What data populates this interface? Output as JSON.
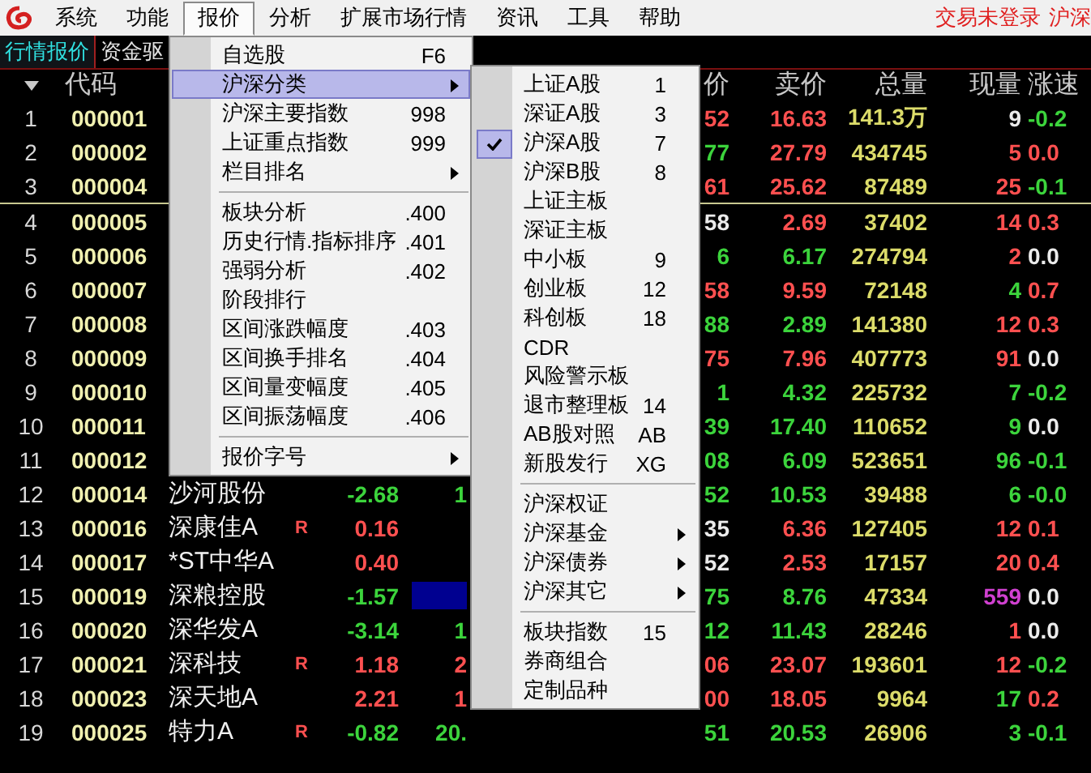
{
  "menubar": {
    "items": [
      {
        "label": "系统",
        "selected": false
      },
      {
        "label": "功能",
        "selected": false
      },
      {
        "label": "报价",
        "selected": true
      },
      {
        "label": "分析",
        "selected": false
      },
      {
        "label": "扩展市场行情",
        "selected": false
      },
      {
        "label": "资讯",
        "selected": false
      },
      {
        "label": "工具",
        "selected": false
      },
      {
        "label": "帮助",
        "selected": false
      }
    ],
    "login_status": "交易未登录",
    "market": "沪深"
  },
  "tabs": [
    {
      "label": "行情报价",
      "selected": true
    },
    {
      "label": "资金驱",
      "selected": false
    }
  ],
  "table": {
    "header": {
      "code": "代码",
      "bid": "价",
      "ask": "卖价",
      "volume": "总量",
      "current": "现量",
      "speed": "涨速"
    },
    "rows": [
      {
        "no": "1",
        "code": "000001",
        "bid": {
          "text": "52",
          "color": "#ff5050"
        },
        "ask": {
          "text": "16.63",
          "color": "#ff5050"
        },
        "volume": "141.3万",
        "current": {
          "text": "9",
          "color": "#ebebeb"
        },
        "speed": {
          "text": "-0.2",
          "color": "#3cd43c"
        },
        "marked": false,
        "divider_below": false
      },
      {
        "no": "2",
        "code": "000002",
        "bid": {
          "text": "77",
          "color": "#3cd43c"
        },
        "ask": {
          "text": "27.79",
          "color": "#ff5050"
        },
        "volume": "434745",
        "current": {
          "text": "5",
          "color": "#ff5050"
        },
        "speed": {
          "text": "0.0",
          "color": "#ff5050"
        },
        "marked": false,
        "divider_below": false
      },
      {
        "no": "3",
        "code": "000004",
        "bid": {
          "text": "61",
          "color": "#ff5050"
        },
        "ask": {
          "text": "25.62",
          "color": "#ff5050"
        },
        "volume": "87489",
        "current": {
          "text": "25",
          "color": "#ff5050"
        },
        "speed": {
          "text": "-0.1",
          "color": "#3cd43c"
        },
        "marked": false,
        "divider_below": true
      },
      {
        "no": "4",
        "code": "000005",
        "bid": {
          "text": "58",
          "color": "#ebebeb"
        },
        "ask": {
          "text": "2.69",
          "color": "#ff5050"
        },
        "volume": "37402",
        "current": {
          "text": "14",
          "color": "#ff5050"
        },
        "speed": {
          "text": "0.3",
          "color": "#ff5050"
        },
        "marked": false,
        "divider_below": false
      },
      {
        "no": "5",
        "code": "000006",
        "bid": {
          "text": "6",
          "color": "#3cd43c"
        },
        "ask": {
          "text": "6.17",
          "color": "#3cd43c"
        },
        "volume": "274794",
        "current": {
          "text": "2",
          "color": "#ff5050"
        },
        "speed": {
          "text": "0.0",
          "color": "#ebebeb"
        },
        "marked": false,
        "divider_below": false
      },
      {
        "no": "6",
        "code": "000007",
        "bid": {
          "text": "58",
          "color": "#ff5050"
        },
        "ask": {
          "text": "9.59",
          "color": "#ff5050"
        },
        "volume": "72148",
        "current": {
          "text": "4",
          "color": "#3cd43c"
        },
        "speed": {
          "text": "0.7",
          "color": "#ff5050"
        },
        "marked": false,
        "divider_below": false
      },
      {
        "no": "7",
        "code": "000008",
        "bid": {
          "text": "88",
          "color": "#3cd43c"
        },
        "ask": {
          "text": "2.89",
          "color": "#3cd43c"
        },
        "volume": "141380",
        "current": {
          "text": "12",
          "color": "#ff5050"
        },
        "speed": {
          "text": "0.3",
          "color": "#ff5050"
        },
        "marked": false,
        "divider_below": false
      },
      {
        "no": "8",
        "code": "000009",
        "bid": {
          "text": "75",
          "color": "#ff5050"
        },
        "ask": {
          "text": "7.96",
          "color": "#ff5050"
        },
        "volume": "407773",
        "current": {
          "text": "91",
          "color": "#ff5050"
        },
        "speed": {
          "text": "0.0",
          "color": "#ebebeb"
        },
        "marked": false,
        "divider_below": false
      },
      {
        "no": "9",
        "code": "000010",
        "bid": {
          "text": "1",
          "color": "#3cd43c"
        },
        "ask": {
          "text": "4.32",
          "color": "#3cd43c"
        },
        "volume": "225732",
        "current": {
          "text": "7",
          "color": "#3cd43c"
        },
        "speed": {
          "text": "-0.2",
          "color": "#3cd43c"
        },
        "marked": false,
        "divider_below": false
      },
      {
        "no": "10",
        "code": "000011",
        "bid": {
          "text": "39",
          "color": "#3cd43c"
        },
        "ask": {
          "text": "17.40",
          "color": "#3cd43c"
        },
        "volume": "110652",
        "current": {
          "text": "9",
          "color": "#3cd43c"
        },
        "speed": {
          "text": "0.0",
          "color": "#ebebeb"
        },
        "marked": false,
        "divider_below": false
      },
      {
        "no": "11",
        "code": "000012",
        "bid": {
          "text": "08",
          "color": "#3cd43c"
        },
        "ask": {
          "text": "6.09",
          "color": "#3cd43c"
        },
        "volume": "523651",
        "current": {
          "text": "96",
          "color": "#3cd43c"
        },
        "speed": {
          "text": "-0.1",
          "color": "#3cd43c"
        },
        "marked": false,
        "divider_below": false
      },
      {
        "no": "12",
        "code": "000014",
        "name": "沙河股份",
        "change": {
          "text": "-2.68",
          "color": "#3cd43c"
        },
        "col_6": {
          "text": "1",
          "color": "#3cd43c"
        },
        "bid": {
          "text": "52",
          "color": "#3cd43c"
        },
        "ask": {
          "text": "10.53",
          "color": "#3cd43c"
        },
        "volume": "39488",
        "current": {
          "text": "6",
          "color": "#3cd43c"
        },
        "speed": {
          "text": "-0.0",
          "color": "#3cd43c"
        },
        "marked": false,
        "divider_below": false
      },
      {
        "no": "13",
        "code": "000016",
        "name": "深康佳A",
        "flag": "R",
        "change": {
          "text": "0.16",
          "color": "#ff5050"
        },
        "bid": {
          "text": "35",
          "color": "#ebebeb"
        },
        "ask": {
          "text": "6.36",
          "color": "#ff5050"
        },
        "volume": "127405",
        "current": {
          "text": "12",
          "color": "#ff5050"
        },
        "speed": {
          "text": "0.1",
          "color": "#ff5050"
        },
        "marked": false,
        "divider_below": false
      },
      {
        "no": "14",
        "code": "000017",
        "name": "*ST中华A",
        "change": {
          "text": "0.40",
          "color": "#ff5050"
        },
        "bid": {
          "text": "52",
          "color": "#ebebeb"
        },
        "ask": {
          "text": "2.53",
          "color": "#ff5050"
        },
        "volume": "17157",
        "current": {
          "text": "20",
          "color": "#ff5050"
        },
        "speed": {
          "text": "0.4",
          "color": "#ff5050"
        },
        "marked": false,
        "divider_below": false
      },
      {
        "no": "15",
        "code": "000019",
        "name": "深粮控股",
        "change": {
          "text": "-1.57",
          "color": "#3cd43c"
        },
        "bid": {
          "text": "75",
          "color": "#3cd43c"
        },
        "ask": {
          "text": "8.76",
          "color": "#3cd43c"
        },
        "volume": "47334",
        "current": {
          "text": "559",
          "color": "#d040d0"
        },
        "speed": {
          "text": "0.0",
          "color": "#ebebeb"
        },
        "marked": true,
        "divider_below": false
      },
      {
        "no": "16",
        "code": "000020",
        "name": "深华发A",
        "change": {
          "text": "-3.14",
          "color": "#3cd43c"
        },
        "col_6": {
          "text": "1",
          "color": "#3cd43c"
        },
        "bid": {
          "text": "12",
          "color": "#3cd43c"
        },
        "ask": {
          "text": "11.43",
          "color": "#3cd43c"
        },
        "volume": "28246",
        "current": {
          "text": "1",
          "color": "#ff5050"
        },
        "speed": {
          "text": "0.0",
          "color": "#ebebeb"
        },
        "marked": false,
        "divider_below": false
      },
      {
        "no": "17",
        "code": "000021",
        "name": "深科技",
        "flag": "R",
        "change": {
          "text": "1.18",
          "color": "#ff5050"
        },
        "col_6": {
          "text": "2",
          "color": "#ff5050"
        },
        "bid": {
          "text": "06",
          "color": "#ff5050"
        },
        "ask": {
          "text": "23.07",
          "color": "#ff5050"
        },
        "volume": "193601",
        "current": {
          "text": "12",
          "color": "#ff5050"
        },
        "speed": {
          "text": "-0.2",
          "color": "#3cd43c"
        },
        "marked": false,
        "divider_below": false
      },
      {
        "no": "18",
        "code": "000023",
        "name": "深天地A",
        "change": {
          "text": "2.21",
          "color": "#ff5050"
        },
        "col_6": {
          "text": "1",
          "color": "#ff5050"
        },
        "bid": {
          "text": "00",
          "color": "#ff5050"
        },
        "ask": {
          "text": "18.05",
          "color": "#ff5050"
        },
        "volume": "9964",
        "current": {
          "text": "17",
          "color": "#3cd43c"
        },
        "speed": {
          "text": "0.2",
          "color": "#ff5050"
        },
        "marked": false,
        "divider_below": false
      },
      {
        "no": "19",
        "code": "000025",
        "name": "特力A",
        "flag": "R",
        "change": {
          "text": "-0.82",
          "color": "#3cd43c"
        },
        "col_6": {
          "text": "20.",
          "color": "#3cd43c"
        },
        "bid": {
          "text": "51",
          "color": "#3cd43c"
        },
        "ask": {
          "text": "20.53",
          "color": "#3cd43c"
        },
        "volume": "26906",
        "current": {
          "text": "3",
          "color": "#3cd43c"
        },
        "speed": {
          "text": "-0.1",
          "color": "#3cd43c"
        },
        "marked": false,
        "divider_below": false
      }
    ]
  },
  "quote_menu": [
    {
      "label": "自选股",
      "shortcut": "F6",
      "kind": "item",
      "selected": false
    },
    {
      "label": "沪深分类",
      "kind": "submenu",
      "selected": true
    },
    {
      "label": "沪深主要指数",
      "shortcut": "998",
      "kind": "item",
      "selected": false
    },
    {
      "label": "上证重点指数",
      "shortcut": "999",
      "kind": "item",
      "selected": false
    },
    {
      "label": "栏目排名",
      "kind": "submenu",
      "selected": false
    },
    {
      "kind": "separator"
    },
    {
      "label": "板块分析",
      "shortcut": ".400",
      "kind": "item",
      "selected": false
    },
    {
      "label": "历史行情.指标排序",
      "shortcut": ".401",
      "kind": "item",
      "selected": false
    },
    {
      "label": "强弱分析",
      "shortcut": ".402",
      "kind": "item",
      "selected": false
    },
    {
      "label": "阶段排行",
      "kind": "item",
      "selected": false
    },
    {
      "label": "区间涨跌幅度",
      "shortcut": ".403",
      "kind": "item",
      "selected": false
    },
    {
      "label": "区间换手排名",
      "shortcut": ".404",
      "kind": "item",
      "selected": false
    },
    {
      "label": "区间量变幅度",
      "shortcut": ".405",
      "kind": "item",
      "selected": false
    },
    {
      "label": "区间振荡幅度",
      "shortcut": ".406",
      "kind": "item",
      "selected": false
    },
    {
      "kind": "separator"
    },
    {
      "label": "报价字号",
      "kind": "submenu",
      "selected": false
    }
  ],
  "category_menu": [
    {
      "label": "上证A股",
      "shortcut": "1",
      "kind": "item",
      "checked": false
    },
    {
      "label": "深证A股",
      "shortcut": "3",
      "kind": "item",
      "checked": false
    },
    {
      "label": "沪深A股",
      "shortcut": "7",
      "kind": "item",
      "checked": true
    },
    {
      "label": "沪深B股",
      "shortcut": "8",
      "kind": "item",
      "checked": false
    },
    {
      "label": "上证主板",
      "kind": "item",
      "checked": false
    },
    {
      "label": "深证主板",
      "kind": "item",
      "checked": false
    },
    {
      "label": "中小板",
      "shortcut": "9",
      "kind": "item",
      "checked": false
    },
    {
      "label": "创业板",
      "shortcut": "12",
      "kind": "item",
      "checked": false
    },
    {
      "label": "科创板",
      "shortcut": "18",
      "kind": "item",
      "checked": false
    },
    {
      "label": "CDR",
      "kind": "item",
      "checked": false
    },
    {
      "label": "风险警示板",
      "kind": "item",
      "checked": false
    },
    {
      "label": "退市整理板",
      "shortcut": "14",
      "kind": "item",
      "checked": false
    },
    {
      "label": "AB股对照",
      "shortcut": "AB",
      "kind": "item",
      "checked": false
    },
    {
      "label": "新股发行",
      "shortcut": "XG",
      "kind": "item",
      "checked": false
    },
    {
      "kind": "separator"
    },
    {
      "label": "沪深权证",
      "kind": "item",
      "checked": false
    },
    {
      "label": "沪深基金",
      "kind": "submenu",
      "checked": false
    },
    {
      "label": "沪深债券",
      "kind": "submenu",
      "checked": false
    },
    {
      "label": "沪深其它",
      "kind": "submenu",
      "checked": false
    },
    {
      "kind": "separator"
    },
    {
      "label": "板块指数",
      "shortcut": "15",
      "kind": "item",
      "checked": false
    },
    {
      "label": "券商组合",
      "kind": "item",
      "checked": false
    },
    {
      "label": "定制品种",
      "kind": "item",
      "checked": false
    }
  ]
}
